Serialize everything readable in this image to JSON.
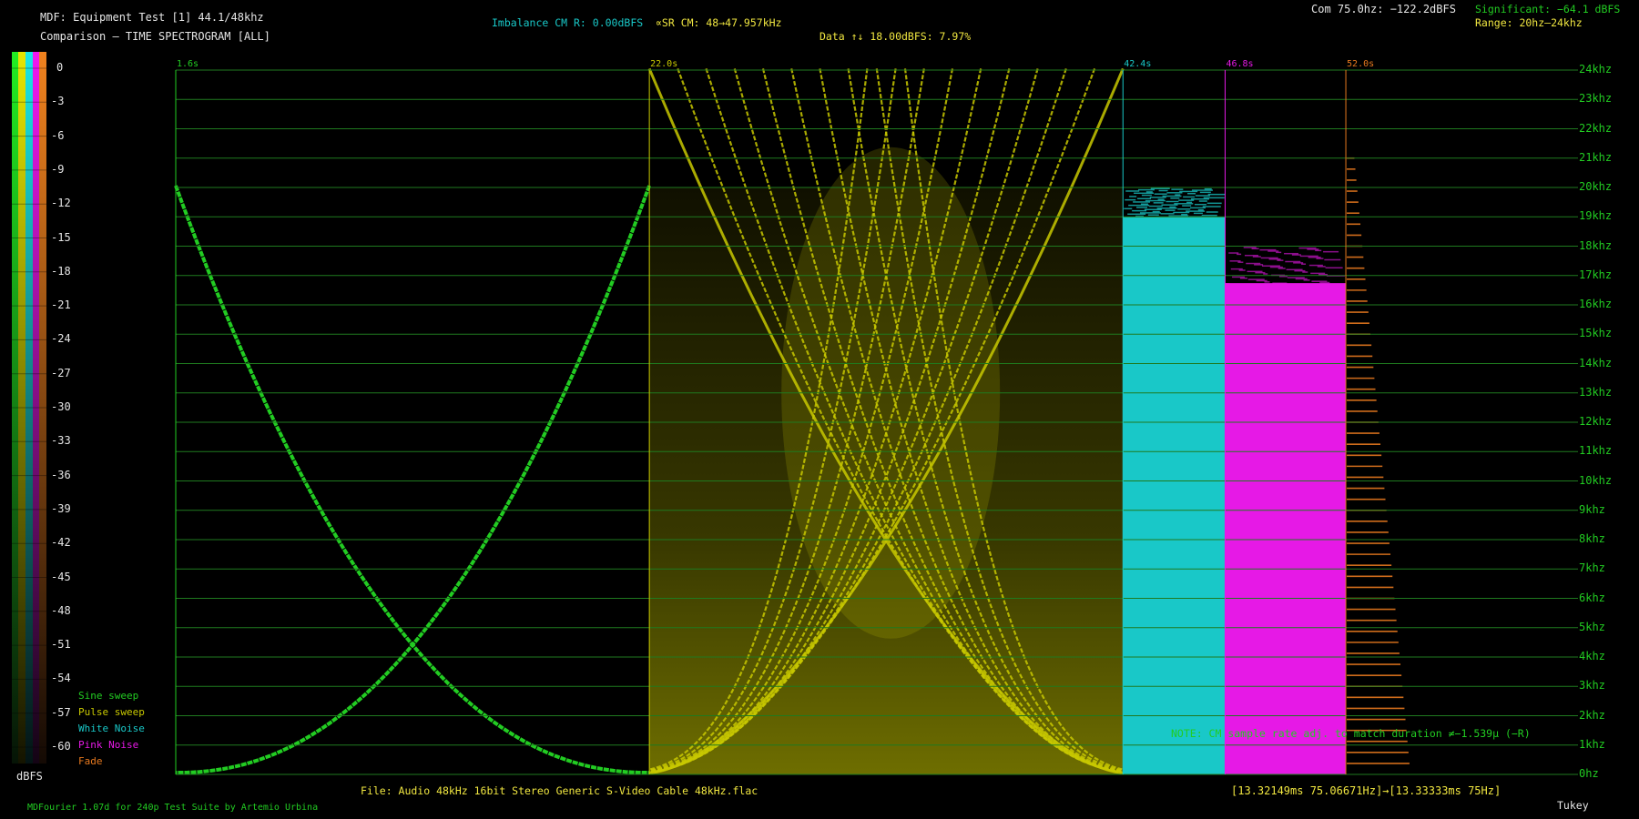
{
  "header": {
    "title_line": "MDF: Equipment Test [1] 44.1/48khz",
    "subtitle_line": "Comparison – TIME SPECTROGRAM [ALL]",
    "imbalance": "Imbalance CM R: 0.00dBFS",
    "sr_cm": "∝SR CM: 48→47.957kHz",
    "data_line": "Data ↑↓ 18.00dBFS: 7.97%",
    "com_line": "Com 75.0hz: −122.2dBFS",
    "significant_line": "Significant: −64.1 dBFS",
    "range_line": "Range: 20hz–24khz"
  },
  "colorbar": {
    "labels": [
      "0",
      "-3",
      "-6",
      "-9",
      "-12",
      "-15",
      "-18",
      "-21",
      "-24",
      "-27",
      "-30",
      "-33",
      "-36",
      "-39",
      "-42",
      "-45",
      "-48",
      "-51",
      "-54",
      "-57",
      "-60"
    ],
    "unit_label": "dBFS"
  },
  "legend": [
    {
      "label": "Sine sweep",
      "color": "#22cc22"
    },
    {
      "label": "Pulse sweep",
      "color": "#c8c800"
    },
    {
      "label": "White Noise",
      "color": "#19c8c8"
    },
    {
      "label": "Pink Noise",
      "color": "#e619e6"
    },
    {
      "label": "Fade",
      "color": "#e6781e"
    }
  ],
  "footer": {
    "file_line": "File: Audio    48kHz 16bit Stereo Generic S-Video Cable 48kHz.flac",
    "frame_line": "[13.32149ms 75.06671Hz]→[13.33333ms 75Hz]",
    "credit_line": "MDFourier 1.07d for 240p Test Suite by Artemio Urbina",
    "window_line": "Tukey",
    "note_line": "NOTE: CM sample rate adj. to match duration ≠−1.539μ (−R)"
  },
  "colors": {
    "background": "#000000",
    "grid": "#1f7a1f",
    "sine": "#22cc22",
    "pulse": "#c8c800",
    "white": "#19c8c8",
    "pink": "#e619e6",
    "fade": "#e6781e",
    "yellow_text": "#f0e640",
    "cyan_text": "#19c8c8",
    "white_text": "#e6e6e6",
    "green_text": "#22cc22"
  },
  "chart_data": {
    "type": "heatmap",
    "title": "TIME SPECTROGRAM [ALL]",
    "xlabel": "",
    "ylabel": "",
    "y_ticks": [
      "24khz",
      "23khz",
      "22khz",
      "21khz",
      "20khz",
      "19khz",
      "18khz",
      "17khz",
      "16khz",
      "15khz",
      "14khz",
      "13khz",
      "12khz",
      "11khz",
      "10khz",
      "9khz",
      "8khz",
      "7khz",
      "6khz",
      "5khz",
      "4khz",
      "3khz",
      "2khz",
      "1khz",
      "0hz"
    ],
    "ylim": [
      0,
      24000
    ],
    "xlim": [
      1.6,
      62.0
    ],
    "segment_markers": [
      {
        "label": "1.6s",
        "time": 1.6,
        "color": "#22cc22"
      },
      {
        "label": "22.0s",
        "time": 22.0,
        "color": "#c8c800"
      },
      {
        "label": "42.4s",
        "time": 42.4,
        "color": "#19c8c8"
      },
      {
        "label": "46.8s",
        "time": 46.8,
        "color": "#e619e6"
      },
      {
        "label": "52.0s",
        "time": 52.0,
        "color": "#e6781e"
      }
    ],
    "series": [
      {
        "name": "Sine sweep",
        "start": 1.6,
        "end": 22.0,
        "max_freq_hz": 20000
      },
      {
        "name": "Pulse sweep",
        "start": 22.0,
        "end": 42.4,
        "max_freq_hz": 24000
      },
      {
        "name": "White Noise",
        "start": 42.4,
        "end": 46.8,
        "max_freq_hz": 20000
      },
      {
        "name": "Pink Noise",
        "start": 46.8,
        "end": 52.0,
        "max_freq_hz": 18000
      },
      {
        "name": "Fade",
        "start": 52.0,
        "end": 62.0,
        "max_freq_hz": 21000
      }
    ],
    "db_range": [
      0,
      -60
    ]
  }
}
